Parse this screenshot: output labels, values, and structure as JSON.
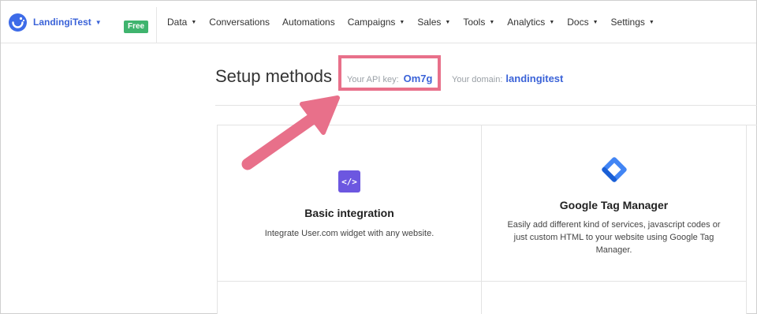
{
  "brand": {
    "name": "LandingiTest",
    "plan_badge": "Free"
  },
  "nav": {
    "items": [
      {
        "label": "Data",
        "dropdown": true
      },
      {
        "label": "Conversations",
        "dropdown": false
      },
      {
        "label": "Automations",
        "dropdown": false
      },
      {
        "label": "Campaigns",
        "dropdown": true
      },
      {
        "label": "Sales",
        "dropdown": true
      },
      {
        "label": "Tools",
        "dropdown": true
      },
      {
        "label": "Analytics",
        "dropdown": true
      },
      {
        "label": "Docs",
        "dropdown": true
      },
      {
        "label": "Settings",
        "dropdown": true
      }
    ]
  },
  "page": {
    "title": "Setup methods",
    "api_key_label": "Your API key:",
    "api_key_value": "Om7g",
    "domain_label": "Your domain:",
    "domain_value": "landingitest"
  },
  "cards": {
    "basic": {
      "icon": "code-icon",
      "icon_text": "</>",
      "title": "Basic integration",
      "description": "Integrate User.com widget with any website."
    },
    "gtm": {
      "icon": "google-tag-manager-icon",
      "title": "Google Tag Manager",
      "description": "Easily add different kind of services, javascript codes or just custom HTML to your website using Google Tag Manager."
    }
  },
  "colors": {
    "accent": "#3b63d8",
    "badge": "#3fb46e",
    "highlight": "#e8708a",
    "code_icon_bg": "#6c57e0",
    "gtm_blue": "#4285f4"
  }
}
